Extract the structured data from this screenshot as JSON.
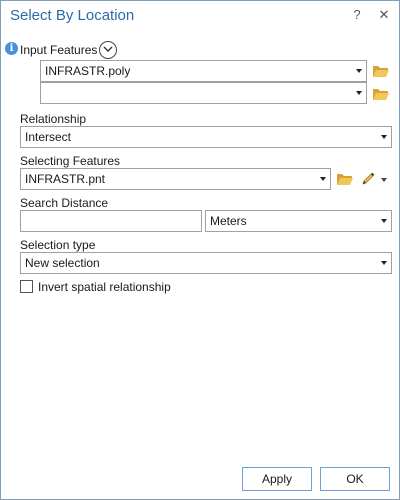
{
  "dialog": {
    "title": "Select By Location",
    "help_glyph": "?",
    "close_glyph": "✕"
  },
  "input_features": {
    "label": "Input Features",
    "info_icon_glyph": "i",
    "rows": [
      {
        "value": "INFRASTR.poly"
      },
      {
        "value": ""
      }
    ]
  },
  "relationship": {
    "label": "Relationship",
    "value": "Intersect"
  },
  "selecting_features": {
    "label": "Selecting Features",
    "value": "INFRASTR.pnt"
  },
  "search_distance": {
    "label": "Search Distance",
    "value": "",
    "unit": "Meters"
  },
  "selection_type": {
    "label": "Selection type",
    "value": "New selection"
  },
  "invert": {
    "label": "Invert spatial relationship",
    "checked": false
  },
  "buttons": {
    "apply": "Apply",
    "ok": "OK"
  },
  "colors": {
    "title": "#2f6aa6",
    "info_icon": "#4a90d9",
    "folder": "#e8b94a",
    "button_border": "#6f9fd3"
  }
}
